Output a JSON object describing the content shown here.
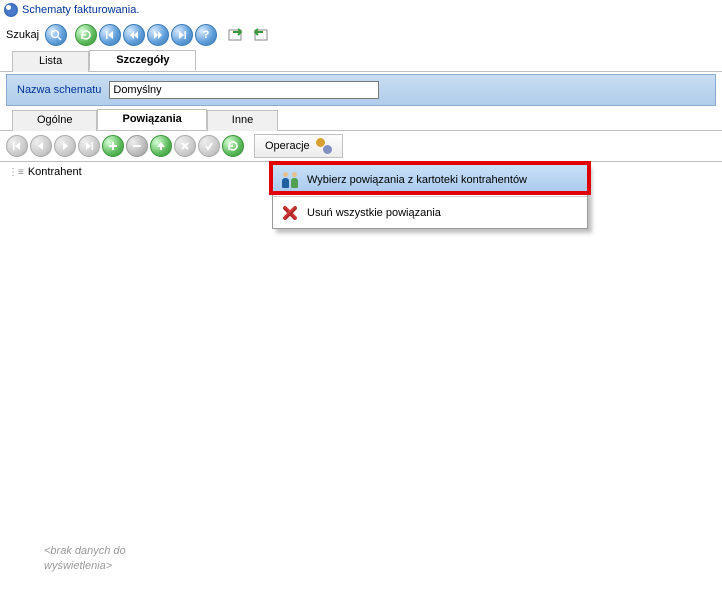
{
  "window": {
    "title": "Schematy fakturowania."
  },
  "toolbar": {
    "search_label": "Szukaj"
  },
  "tabs1": {
    "list": "Lista",
    "details": "Szczegóły"
  },
  "schema": {
    "label": "Nazwa schematu",
    "value": "Domyślny"
  },
  "tabs2": {
    "general": "Ogólne",
    "links": "Powiązania",
    "other": "Inne"
  },
  "ops_button": "Operacje",
  "column_header": "Kontrahent",
  "dropdown": {
    "item_select": "Wybierz powiązania z kartoteki kontrahentów",
    "item_delete": "Usuń wszystkie powiązania"
  },
  "empty_message_1": "<brak danych do",
  "empty_message_2": "wyświetlenia>"
}
